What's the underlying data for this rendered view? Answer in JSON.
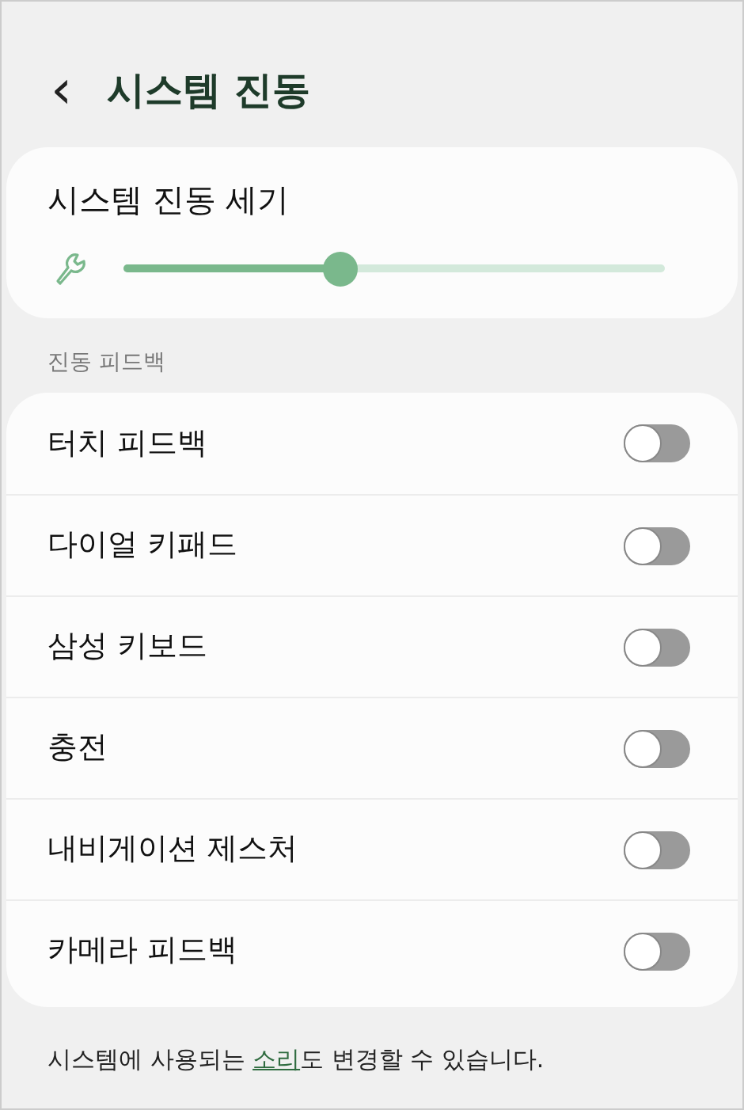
{
  "header": {
    "back": "‹",
    "title": "시스템 진동"
  },
  "intensity": {
    "label": "시스템 진동 세기",
    "level": 0.4
  },
  "section_label": "진동 피드백",
  "toggles": [
    {
      "label": "터치 피드백",
      "on": false
    },
    {
      "label": "다이얼 키패드",
      "on": false
    },
    {
      "label": "삼성 키보드",
      "on": false
    },
    {
      "label": "충전",
      "on": false
    },
    {
      "label": "내비게이션 제스처",
      "on": false
    },
    {
      "label": "카메라 피드백",
      "on": false
    }
  ],
  "footer": {
    "before": "시스템에 사용되는 ",
    "link": "소리",
    "after": "도 변경할 수 있습니다."
  }
}
